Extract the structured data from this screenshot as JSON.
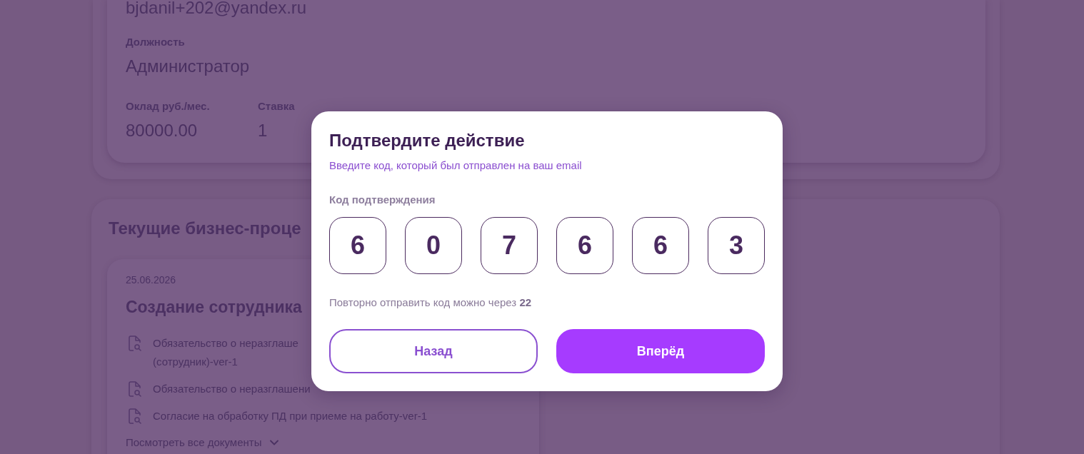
{
  "profile_card": {
    "email": "bjdanil+202@yandex.ru",
    "fields": [
      {
        "label": "Должность",
        "value": "Администратор"
      }
    ],
    "row_fields": [
      {
        "label": "Оклад руб./мес.",
        "value": "80000.00"
      },
      {
        "label": "Ставка",
        "value": "1"
      }
    ]
  },
  "processes": {
    "title": "Текущие бизнес-проце",
    "cards": [
      {
        "date": "25.06.2026",
        "title": "Создание сотрудника",
        "documents": [
          {
            "name": "Обязательство о неразглаше\n(сотрудник)-ver-1"
          },
          {
            "name": "Обязательство о неразглашени"
          },
          {
            "name": "Согласие на обработку ПД при приеме на работу-ver-1"
          }
        ],
        "show_all": "Посмотреть все документы"
      }
    ]
  },
  "dialog": {
    "title": "Подтвердите действие",
    "subtitle": "Введите код, который был отправлен на ваш email",
    "code_label": "Код подтверждения",
    "code_digits": [
      "6",
      "0",
      "7",
      "6",
      "6",
      "3"
    ],
    "resend_text": "Повторно отправить код можно через **22**",
    "buttons": [
      {
        "label": "Назад",
        "kind": "secondary"
      },
      {
        "label": "Вперёд",
        "kind": "primary"
      }
    ]
  }
}
